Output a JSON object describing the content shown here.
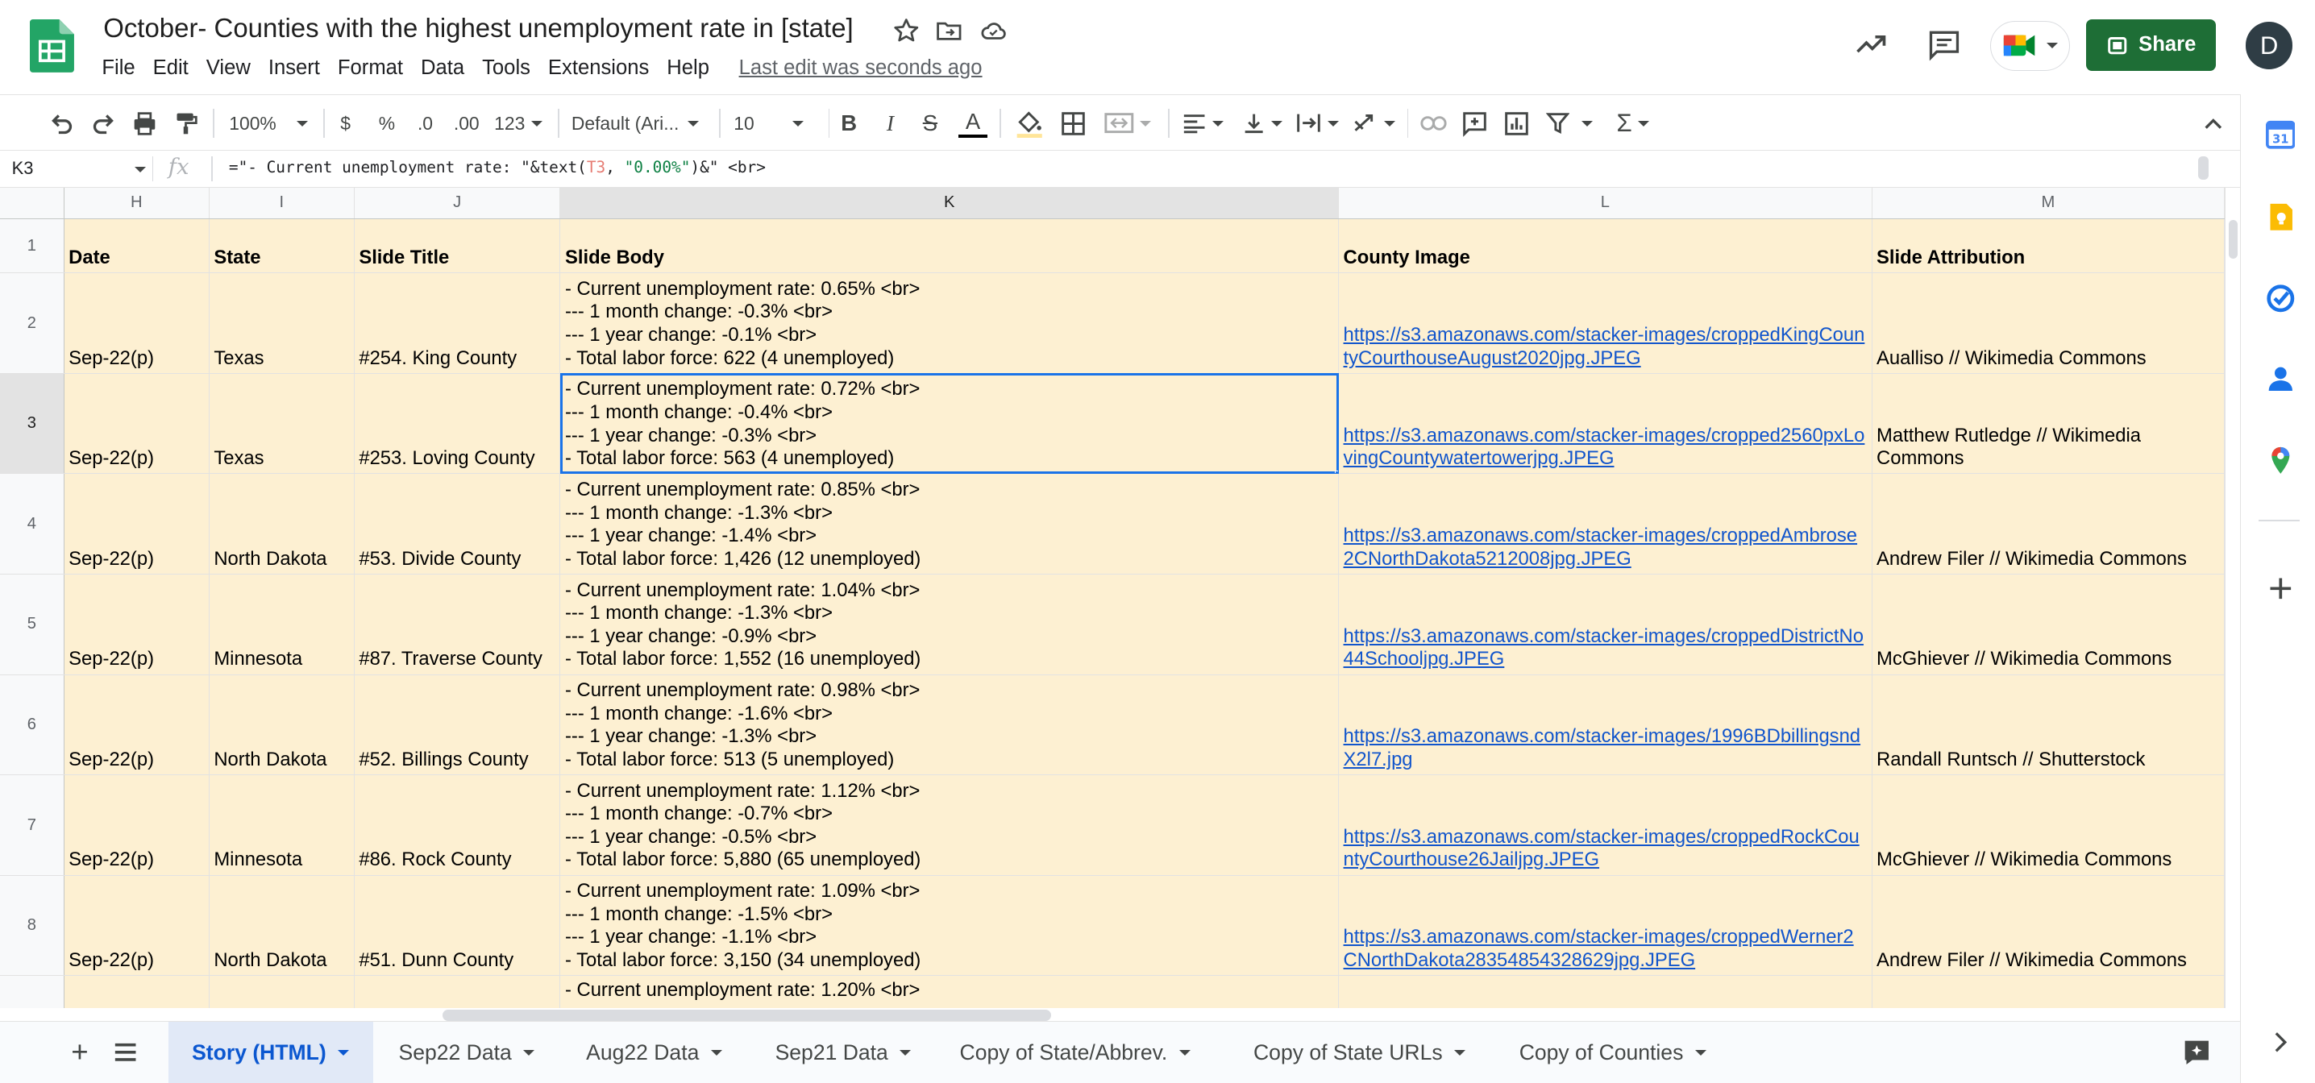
{
  "app": {
    "title": "October- Counties with the highest unemployment rate in [state]",
    "last_edit": "Last edit was seconds ago",
    "share_label": "Share",
    "avatar_initial": "D"
  },
  "menu": [
    "File",
    "Edit",
    "View",
    "Insert",
    "Format",
    "Data",
    "Tools",
    "Extensions",
    "Help"
  ],
  "toolbar": {
    "zoom": "100%",
    "currency": "$",
    "percent": "%",
    "decrease_decimal": ".0",
    "increase_decimal": ".00",
    "number_format": "123",
    "font": "Default (Ari...",
    "font_size": "10"
  },
  "formula_bar": {
    "cell_ref": "K3",
    "fx": "fx",
    "formula_prefix": "=\"- Current unemployment rate: \"&text(",
    "formula_ref": "T3",
    "formula_mid": ", ",
    "formula_str": "\"0.00%\"",
    "formula_suffix": ")&\" <br>"
  },
  "columns": [
    "H",
    "I",
    "J",
    "K",
    "L",
    "M"
  ],
  "header_row": {
    "row": "1",
    "cells": [
      "Date",
      "State",
      "Slide Title",
      "Slide Body",
      "County Image",
      "Slide Attribution"
    ]
  },
  "rows": [
    {
      "row": "2",
      "date": "Sep-22(p)",
      "state": "Texas",
      "title": "#254. King County",
      "body": [
        "- Current unemployment rate: 0.65% <br>",
        "--- 1 month change: -0.3% <br>",
        "--- 1 year change: -0.1% <br>",
        "- Total labor force: 622 (4 unemployed)"
      ],
      "image": "https://s3.amazonaws.com/stacker-images/croppedKingCountyCourthouseAugust2020jpg.JPEG",
      "attribution": "Aualliso // Wikimedia Commons"
    },
    {
      "row": "3",
      "date": "Sep-22(p)",
      "state": "Texas",
      "title": "#253. Loving County",
      "body": [
        "- Current unemployment rate: 0.72% <br>",
        "--- 1 month change: -0.4% <br>",
        "--- 1 year change: -0.3% <br>",
        "- Total labor force: 563 (4 unemployed)"
      ],
      "image": "https://s3.amazonaws.com/stacker-images/cropped2560pxLovingCountywatertowerjpg.JPEG",
      "attribution": "Matthew Rutledge // Wikimedia Commons"
    },
    {
      "row": "4",
      "date": "Sep-22(p)",
      "state": "North Dakota",
      "title": "#53. Divide County",
      "body": [
        "- Current unemployment rate: 0.85% <br>",
        "--- 1 month change: -1.3% <br>",
        "--- 1 year change: -1.4% <br>",
        "- Total labor force: 1,426 (12 unemployed)"
      ],
      "image": "https://s3.amazonaws.com/stacker-images/croppedAmbrose2CNorthDakota5212008jpg.JPEG",
      "attribution": "Andrew Filer // Wikimedia Commons"
    },
    {
      "row": "5",
      "date": "Sep-22(p)",
      "state": "Minnesota",
      "title": "#87. Traverse County",
      "body": [
        "- Current unemployment rate: 1.04% <br>",
        "--- 1 month change: -1.3% <br>",
        "--- 1 year change: -0.9% <br>",
        "- Total labor force: 1,552 (16 unemployed)"
      ],
      "image": "https://s3.amazonaws.com/stacker-images/croppedDistrictNo44Schooljpg.JPEG",
      "attribution": "McGhiever // Wikimedia Commons"
    },
    {
      "row": "6",
      "date": "Sep-22(p)",
      "state": "North Dakota",
      "title": "#52. Billings County",
      "body": [
        "- Current unemployment rate: 0.98% <br>",
        "--- 1 month change: -1.6% <br>",
        "--- 1 year change: -1.3% <br>",
        "- Total labor force: 513 (5 unemployed)"
      ],
      "image": "https://s3.amazonaws.com/stacker-images/1996BDbillingsndX2l7.jpg",
      "attribution": "Randall Runtsch // Shutterstock"
    },
    {
      "row": "7",
      "date": "Sep-22(p)",
      "state": "Minnesota",
      "title": "#86. Rock County",
      "body": [
        "- Current unemployment rate: 1.12% <br>",
        "--- 1 month change: -0.7% <br>",
        "--- 1 year change: -0.5% <br>",
        "- Total labor force: 5,880 (65 unemployed)"
      ],
      "image": "https://s3.amazonaws.com/stacker-images/croppedRockCountyCourthouse26Jailjpg.JPEG",
      "attribution": "McGhiever // Wikimedia Commons"
    },
    {
      "row": "8",
      "date": "Sep-22(p)",
      "state": "North Dakota",
      "title": "#51. Dunn County",
      "body": [
        "- Current unemployment rate: 1.09% <br>",
        "--- 1 month change: -1.5% <br>",
        "--- 1 year change: -1.1% <br>",
        "- Total labor force: 3,150 (34 unemployed)"
      ],
      "image": "https://s3.amazonaws.com/stacker-images/croppedWerner2CNorthDakota28354854328629jpg.JPEG",
      "attribution": "Andrew Filer // Wikimedia Commons"
    },
    {
      "row": "",
      "date": "",
      "state": "",
      "title": "",
      "body": [
        "- Current unemployment rate: 1.20% <br>",
        "",
        "",
        ""
      ],
      "image": "",
      "attribution": ""
    }
  ],
  "sheet_tabs": [
    {
      "label": "Story (HTML)",
      "active": true
    },
    {
      "label": "Sep22 Data",
      "active": false
    },
    {
      "label": "Aug22 Data",
      "active": false
    },
    {
      "label": "Sep21 Data",
      "active": false
    },
    {
      "label": "Copy of State/Abbrev.",
      "active": false
    },
    {
      "label": "Copy of State URLs",
      "active": false
    },
    {
      "label": "Copy of Counties",
      "active": false
    }
  ],
  "side_panel": [
    "calendar-icon",
    "keep-icon",
    "tasks-icon",
    "contacts-icon",
    "maps-icon",
    "add-icon"
  ],
  "colors": {
    "accent": "#1a73e8",
    "share": "#1e6e36",
    "cell_fill": "#fdf0d2",
    "link": "#1155cc"
  }
}
